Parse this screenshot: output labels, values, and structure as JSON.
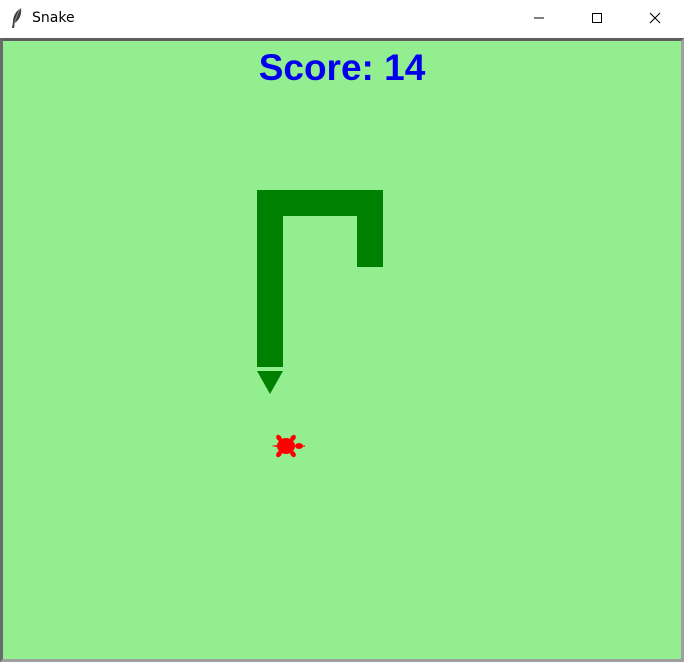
{
  "window": {
    "title": "Snake",
    "icon": "feather-icon"
  },
  "controls": {
    "minimize_icon": "minimize-icon",
    "maximize_icon": "maximize-icon",
    "close_icon": "close-icon"
  },
  "game": {
    "score_text": "Score: 14",
    "background_color": "#93ee8f",
    "snake_color": "#008000",
    "food_color": "#ff0000",
    "score_color": "#0000ee",
    "snake_head_direction": "down",
    "food_icon": "turtle-icon"
  }
}
